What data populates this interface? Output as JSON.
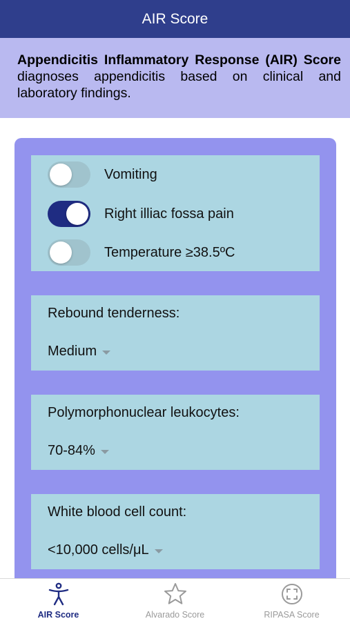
{
  "header": {
    "title": "AIR Score"
  },
  "intro": {
    "bold_text": "Appendicitis Inflammatory Response (AIR) Score",
    "text": " diagnoses appendicitis based on clinical and laboratory findings."
  },
  "toggles": [
    {
      "label": "Vomiting",
      "on": false
    },
    {
      "label": "Right illiac fossa pain",
      "on": true
    },
    {
      "label": "Temperature ≥38.5ºC",
      "on": false
    }
  ],
  "rebound": {
    "label": "Rebound tenderness:",
    "value": "Medium"
  },
  "pmn": {
    "label": "Polymorphonuclear leukocytes:",
    "value": "70-84%"
  },
  "wbc": {
    "label": "White blood cell count:",
    "value": "<10,000 cells/μL"
  },
  "tabs": [
    {
      "label": "AIR Score",
      "icon": "accessibility-icon",
      "active": true
    },
    {
      "label": "Alvarado Score",
      "icon": "star-icon",
      "active": false
    },
    {
      "label": "RIPASA Score",
      "icon": "focus-icon",
      "active": false
    }
  ],
  "colors": {
    "header": "#2f3e8c",
    "intro_bg": "#b9b9f0",
    "card_bg": "#9393ee",
    "panel_bg": "#acd6e2",
    "switch_on": "#1f2c82",
    "tab_active": "#1f2c82",
    "tab_inactive": "#9a9a9a"
  }
}
